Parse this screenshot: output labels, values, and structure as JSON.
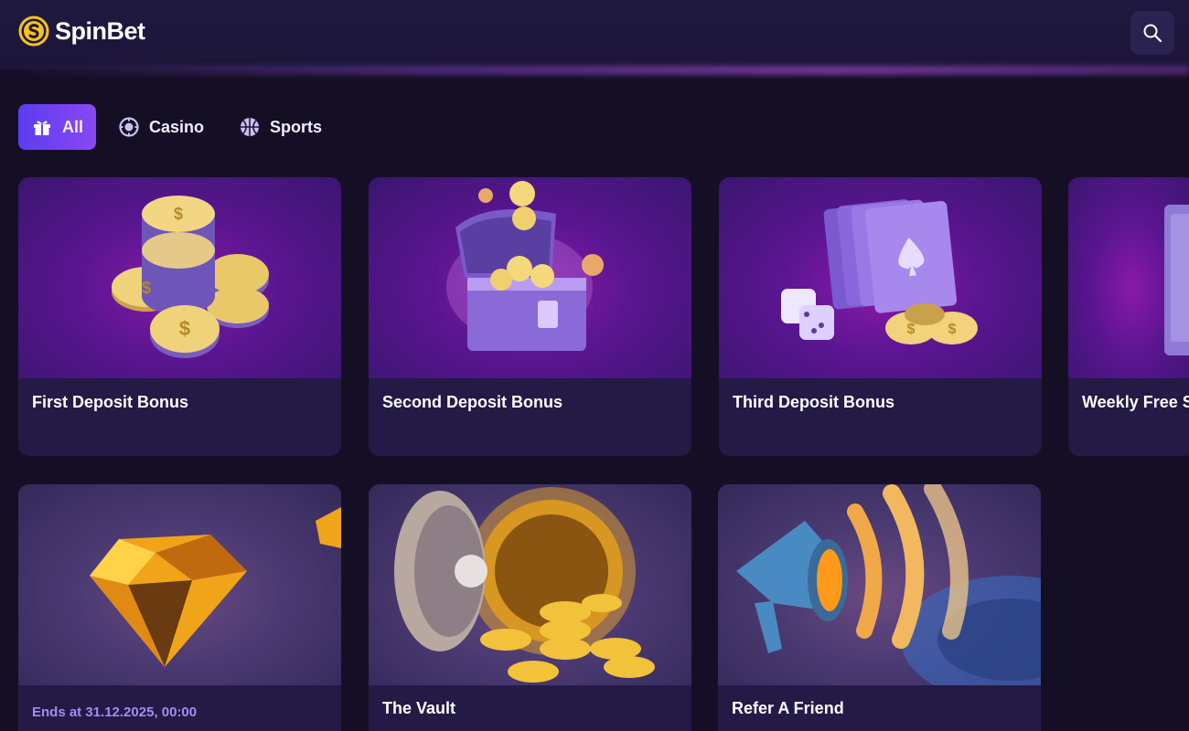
{
  "brand": {
    "name": "SpinBet",
    "accent": "#f5c21b"
  },
  "header": {
    "search_icon": "search-icon"
  },
  "tabs": [
    {
      "label": "All",
      "icon": "gift-icon",
      "active": true
    },
    {
      "label": "Casino",
      "icon": "casino-chip-icon",
      "active": false
    },
    {
      "label": "Sports",
      "icon": "basketball-icon",
      "active": false
    }
  ],
  "promotions": [
    {
      "title": "First Deposit Bonus",
      "art": "coin-stack"
    },
    {
      "title": "Second Deposit Bonus",
      "art": "treasure-chest"
    },
    {
      "title": "Third Deposit Bonus",
      "art": "cards-and-dice"
    },
    {
      "title": "Weekly Free S",
      "art": "partial-card"
    },
    {
      "title": "",
      "ends": "Ends at 31.12.2025, 00:00",
      "art": "diamond"
    },
    {
      "title": "The Vault",
      "art": "vault"
    },
    {
      "title": "Refer A Friend",
      "art": "megaphone"
    }
  ],
  "colors": {
    "active_tab_start": "#5b3df0",
    "active_tab_end": "#8b47f5",
    "card_bg": "#231a45",
    "page_bg": "#150f26"
  }
}
